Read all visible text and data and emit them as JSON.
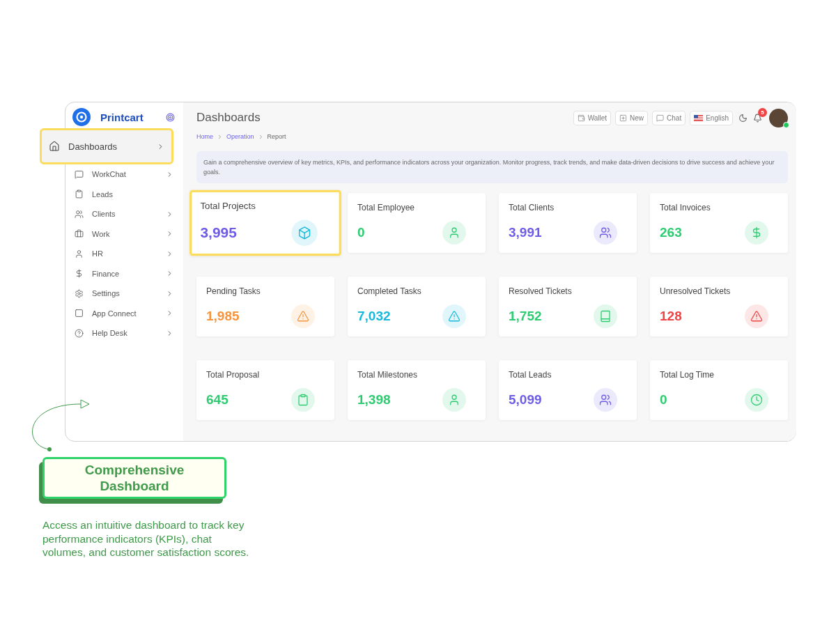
{
  "sidebar": {
    "brand": "Printcart",
    "items": [
      {
        "label": "Dashboards",
        "selected": true,
        "has_submenu": true
      },
      {
        "label": "WorkChat",
        "selected": false,
        "has_submenu": true
      },
      {
        "label": "Leads",
        "selected": false,
        "has_submenu": false
      },
      {
        "label": "Clients",
        "selected": false,
        "has_submenu": true
      },
      {
        "label": "Work",
        "selected": false,
        "has_submenu": true
      },
      {
        "label": "HR",
        "selected": false,
        "has_submenu": true
      },
      {
        "label": "Finance",
        "selected": false,
        "has_submenu": true
      },
      {
        "label": "Settings",
        "selected": false,
        "has_submenu": true
      },
      {
        "label": "App Connect",
        "selected": false,
        "has_submenu": true
      },
      {
        "label": "Help Desk",
        "selected": false,
        "has_submenu": true
      }
    ]
  },
  "header": {
    "title": "Dashboards",
    "actions": [
      {
        "label": "Wallet"
      },
      {
        "label": "New"
      },
      {
        "label": "Chat"
      },
      {
        "label": "English"
      }
    ],
    "notifications": "5"
  },
  "breadcrumb": [
    {
      "label": "Home",
      "current": false
    },
    {
      "label": "Operation",
      "current": false
    },
    {
      "label": "Report",
      "current": true
    }
  ],
  "intro": "Gain a comprehensive overview of key metrics, KPIs, and performance indicators across your organization. Monitor progress, track trends, and make data-driven decisions to drive success and achieve your goals.",
  "cards": [
    {
      "title": "Total Projects",
      "value": "3,995",
      "color": "#6c5ce7",
      "highlighted": true
    },
    {
      "title": "Total Employee",
      "value": "0",
      "color": "#2ecc71",
      "highlighted": false
    },
    {
      "title": "Total Clients",
      "value": "3,991",
      "color": "#6c5ce7",
      "highlighted": false
    },
    {
      "title": "Total Invoices",
      "value": "263",
      "color": "#2ecc71",
      "highlighted": false
    },
    {
      "title": "Pending Tasks",
      "value": "1,985",
      "color": "#f7943c",
      "highlighted": false
    },
    {
      "title": "Completed Tasks",
      "value": "7,032",
      "color": "#17b8dc",
      "highlighted": false
    },
    {
      "title": "Resolved Tickets",
      "value": "1,752",
      "color": "#2ecc71",
      "highlighted": false
    },
    {
      "title": "Unresolved Tickets",
      "value": "128",
      "color": "#ef4444",
      "highlighted": false
    },
    {
      "title": "Total Proposal",
      "value": "645",
      "color": "#2ecc71",
      "highlighted": false
    },
    {
      "title": "Total Milestones",
      "value": "1,398",
      "color": "#2ecc71",
      "highlighted": false
    },
    {
      "title": "Total Leads",
      "value": "5,099",
      "color": "#6c5ce7",
      "highlighted": false
    },
    {
      "title": "Total Log Time",
      "value": "0",
      "color": "#2ecc71",
      "highlighted": false
    }
  ],
  "callout": {
    "title": "Comprehensive Dashboard",
    "text": "Access an intuitive dashboard to track key performance indicators (KPIs), chat volumes, and customer satisfaction scores."
  }
}
